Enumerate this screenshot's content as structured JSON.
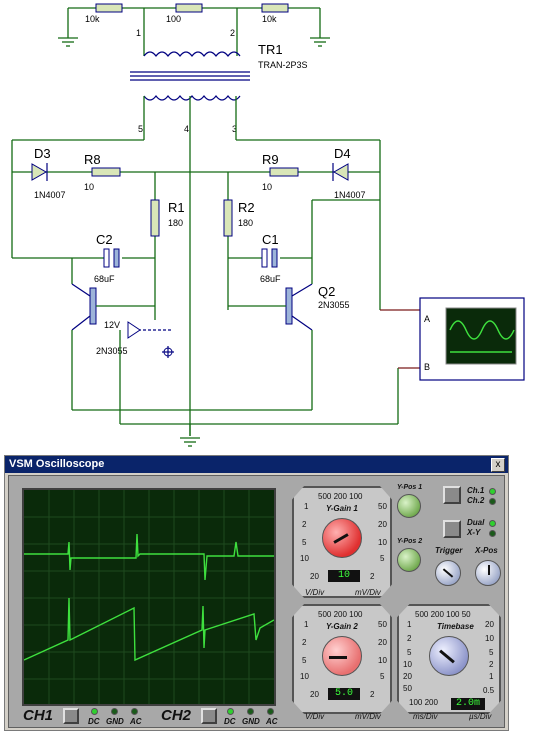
{
  "schematic": {
    "resistors_top": [
      "10k",
      "100",
      "10k"
    ],
    "transformer": {
      "ref": "TR1",
      "model": "TRAN-2P3S",
      "pins": [
        "1",
        "2",
        "5",
        "4",
        "3"
      ]
    },
    "d3": {
      "ref": "D3",
      "model": "1N4007"
    },
    "d4": {
      "ref": "D4",
      "model": "1N4007"
    },
    "r8": {
      "ref": "R8",
      "value": "10"
    },
    "r9": {
      "ref": "R9",
      "value": "10"
    },
    "r1": {
      "ref": "R1",
      "value": "180"
    },
    "r2": {
      "ref": "R2",
      "value": "180"
    },
    "c2": {
      "ref": "C2",
      "value": "68uF"
    },
    "c1": {
      "ref": "C1",
      "value": "68uF"
    },
    "q2": {
      "ref": "Q2",
      "model": "2N3055"
    },
    "q1": {
      "model": "2N3055"
    },
    "battery": "12V",
    "scope_inputs": [
      "A",
      "B"
    ]
  },
  "oscilloscope": {
    "title": "VSM Oscilloscope",
    "close_glyph": "x",
    "ch1_label": "CH1",
    "ch2_label": "CH2",
    "coupling": [
      "DC",
      "GND",
      "AC"
    ],
    "ch1_coupling_active": "DC",
    "ch2_coupling_active": "DC",
    "ygain1": {
      "title": "Y-Gain 1",
      "top_scale": "500 200 100",
      "left": [
        "1",
        "2",
        "5",
        "10",
        "20"
      ],
      "right": [
        "50",
        "20",
        "10",
        "5",
        "2"
      ],
      "readout": "10",
      "unit_left": "V/Div",
      "unit_right": "mV/Div"
    },
    "ygain2": {
      "title": "Y-Gain 2",
      "top_scale": "500 200 100",
      "left": [
        "1",
        "2",
        "5",
        "10",
        "20"
      ],
      "right": [
        "50",
        "20",
        "10",
        "5",
        "2"
      ],
      "readout": "5.0",
      "unit_left": "V/Div",
      "unit_right": "mV/Div"
    },
    "timebase": {
      "title": "Timebase",
      "top_scale": "500 200 100 50",
      "left": [
        "1",
        "2",
        "5",
        "10",
        "20",
        "50"
      ],
      "right": [
        "20",
        "10",
        "5",
        "2",
        "1",
        "0.5"
      ],
      "bottom_scale": "100 200",
      "readout": "2.0m",
      "unit_left": "ms/Div",
      "unit_right": "µs/Div"
    },
    "ypos1": "Y-Pos 1",
    "ypos2": "Y-Pos 2",
    "trigger": "Trigger",
    "xpos": "X-Pos",
    "mode1": [
      "Ch.1",
      "Ch.2"
    ],
    "mode2": [
      "Dual",
      "X-Y"
    ],
    "colors": {
      "titlebar": "#0a246a",
      "trace": "#3ee03e",
      "lcd": "#3cff3c",
      "screen": "#0a2a0a"
    }
  }
}
